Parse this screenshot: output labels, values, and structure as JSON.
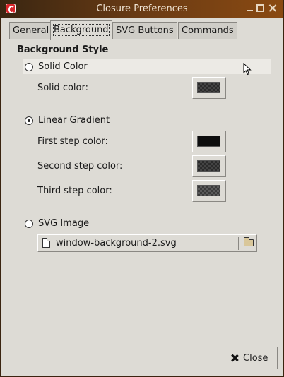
{
  "window": {
    "title": "Closure Preferences"
  },
  "tabs": [
    {
      "label": "General"
    },
    {
      "label": "Background"
    },
    {
      "label": "SVG Buttons"
    },
    {
      "label": "Commands"
    }
  ],
  "active_tab": "Background",
  "section_heading": "Background Style",
  "solid": {
    "radio_label": "Solid Color",
    "checked": false,
    "color_label": "Solid color:"
  },
  "gradient": {
    "radio_label": "Linear Gradient",
    "checked": true,
    "first_label": "First step color:",
    "second_label": "Second step color:",
    "third_label": "Third step color:"
  },
  "svg": {
    "radio_label": "SVG Image",
    "checked": false,
    "file_name": "window-background-2.svg"
  },
  "footer": {
    "close_label": "Close"
  },
  "icons": {
    "app": "closure-app-icon",
    "minimize": "minimize-icon",
    "maximize": "maximize-icon",
    "close": "close-icon",
    "file": "file-icon",
    "folder": "folder-open-icon",
    "close_button": "x-icon",
    "cursor": "mouse-pointer-icon"
  },
  "colors": {
    "titlebar": "#6a3b14",
    "window_bg": "#dddbd5"
  }
}
